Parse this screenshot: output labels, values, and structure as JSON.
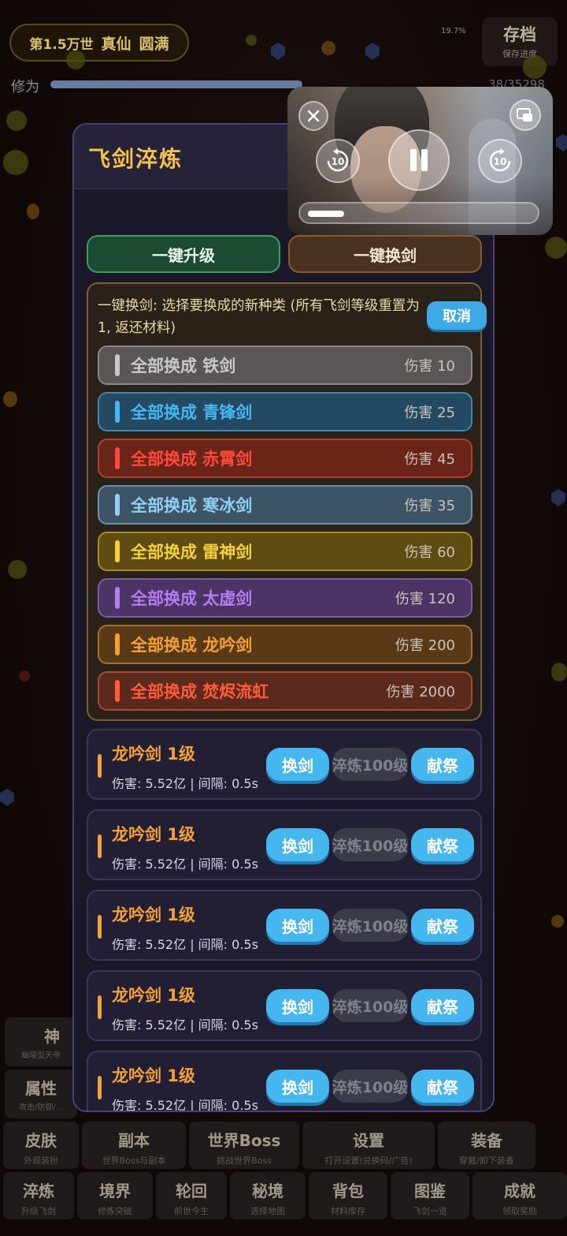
{
  "header": {
    "realm": "第1.5万世",
    "realm_name": "真仙",
    "realm_stage": "圆满",
    "percent_tag": "19.7%",
    "save_title": "存档",
    "save_sub": "保存进度",
    "xiuwei_label": "修为",
    "xiuwei_value": "38/35298"
  },
  "modal": {
    "title": "飞剑淬炼",
    "upgrade_all": "一键升级",
    "swap_all": "一键换剑",
    "swap_desc": "一键换剑: 选择要换成的新种类 (所有飞剑等级重置为1, 返还材料)",
    "cancel": "取消",
    "options": [
      {
        "label": "全部换成 铁剑",
        "damage": "伤害 10",
        "color": "#c8c8c8",
        "bg": "#5a5656",
        "border": "#8a8686"
      },
      {
        "label": "全部换成 青锋剑",
        "damage": "伤害 25",
        "color": "#46b8f0",
        "bg": "#234a62",
        "border": "#3f86b0"
      },
      {
        "label": "全部换成 赤霄剑",
        "damage": "伤害 45",
        "color": "#ff4a3a",
        "bg": "#6a2418",
        "border": "#b0402e"
      },
      {
        "label": "全部换成 寒冰剑",
        "damage": "伤害 35",
        "color": "#8ed0f4",
        "bg": "#3c5466",
        "border": "#6a92ac"
      },
      {
        "label": "全部换成 雷神剑",
        "damage": "伤害 60",
        "color": "#f4d03a",
        "bg": "#5e4c12",
        "border": "#a88c2a"
      },
      {
        "label": "全部换成 太虚剑",
        "damage": "伤害 120",
        "color": "#b27ef0",
        "bg": "#4c3466",
        "border": "#7e5aa8"
      },
      {
        "label": "全部换成 龙吟剑",
        "damage": "伤害 200",
        "color": "#f2a13a",
        "bg": "#5a3a16",
        "border": "#a86e2c"
      },
      {
        "label": "全部换成 焚烬流虹",
        "damage": "伤害 2000",
        "color": "#ff5a3a",
        "bg": "#5c2a1c",
        "border": "#a84a32"
      }
    ],
    "swords": [
      {
        "name": "龙吟剑 1级",
        "stats": "伤害: 5.52亿 | 间隔: 0.5s",
        "swap": "换剑",
        "refine": "淬炼100级",
        "sacrifice": "献祭"
      },
      {
        "name": "龙吟剑 1级",
        "stats": "伤害: 5.52亿 | 间隔: 0.5s",
        "swap": "换剑",
        "refine": "淬炼100级",
        "sacrifice": "献祭"
      },
      {
        "name": "龙吟剑 1级",
        "stats": "伤害: 5.52亿 | 间隔: 0.5s",
        "swap": "换剑",
        "refine": "淬炼100级",
        "sacrifice": "献祭"
      },
      {
        "name": "龙吟剑 1级",
        "stats": "伤害: 5.52亿 | 间隔: 0.5s",
        "swap": "换剑",
        "refine": "淬炼100级",
        "sacrifice": "献祭"
      },
      {
        "name": "龙吟剑 1级",
        "stats": "伤害: 5.52亿 | 间隔: 0.5s",
        "swap": "换剑",
        "refine": "淬炼100级",
        "sacrifice": "献祭"
      }
    ]
  },
  "video": {
    "close_icon": "close-icon",
    "pip_icon": "picture-in-picture-icon",
    "rewind_label": "10",
    "forward_label": "10",
    "pause_icon": "pause-icon",
    "progress": 0.16
  },
  "bottom_nav": {
    "row1": [
      {
        "name": "皮肤",
        "desc": "外观装扮"
      },
      {
        "name": "副本",
        "desc": "世界Boss与副本"
      },
      {
        "name": "世界Boss",
        "desc": "挑战世界Boss"
      },
      {
        "name": "设置",
        "desc": "打开设置(兑换码/广告)"
      },
      {
        "name": "装备",
        "desc": "穿戴/卸下装备"
      }
    ],
    "row2": [
      {
        "name": "淬炼",
        "desc": "升级飞剑"
      },
      {
        "name": "境界",
        "desc": "修炼突破"
      },
      {
        "name": "轮回",
        "desc": "前世今生"
      },
      {
        "name": "秘境",
        "desc": "选择地图"
      },
      {
        "name": "背包",
        "desc": "材料库存"
      },
      {
        "name": "图鉴",
        "desc": "飞剑一览"
      },
      {
        "name": "成就",
        "desc": "领取奖励"
      }
    ],
    "side_left_1": "神",
    "side_left_1_desc": "幽曜型天帝",
    "side_left_2": "属性",
    "side_left_2_desc": "攻击/防御/..."
  }
}
